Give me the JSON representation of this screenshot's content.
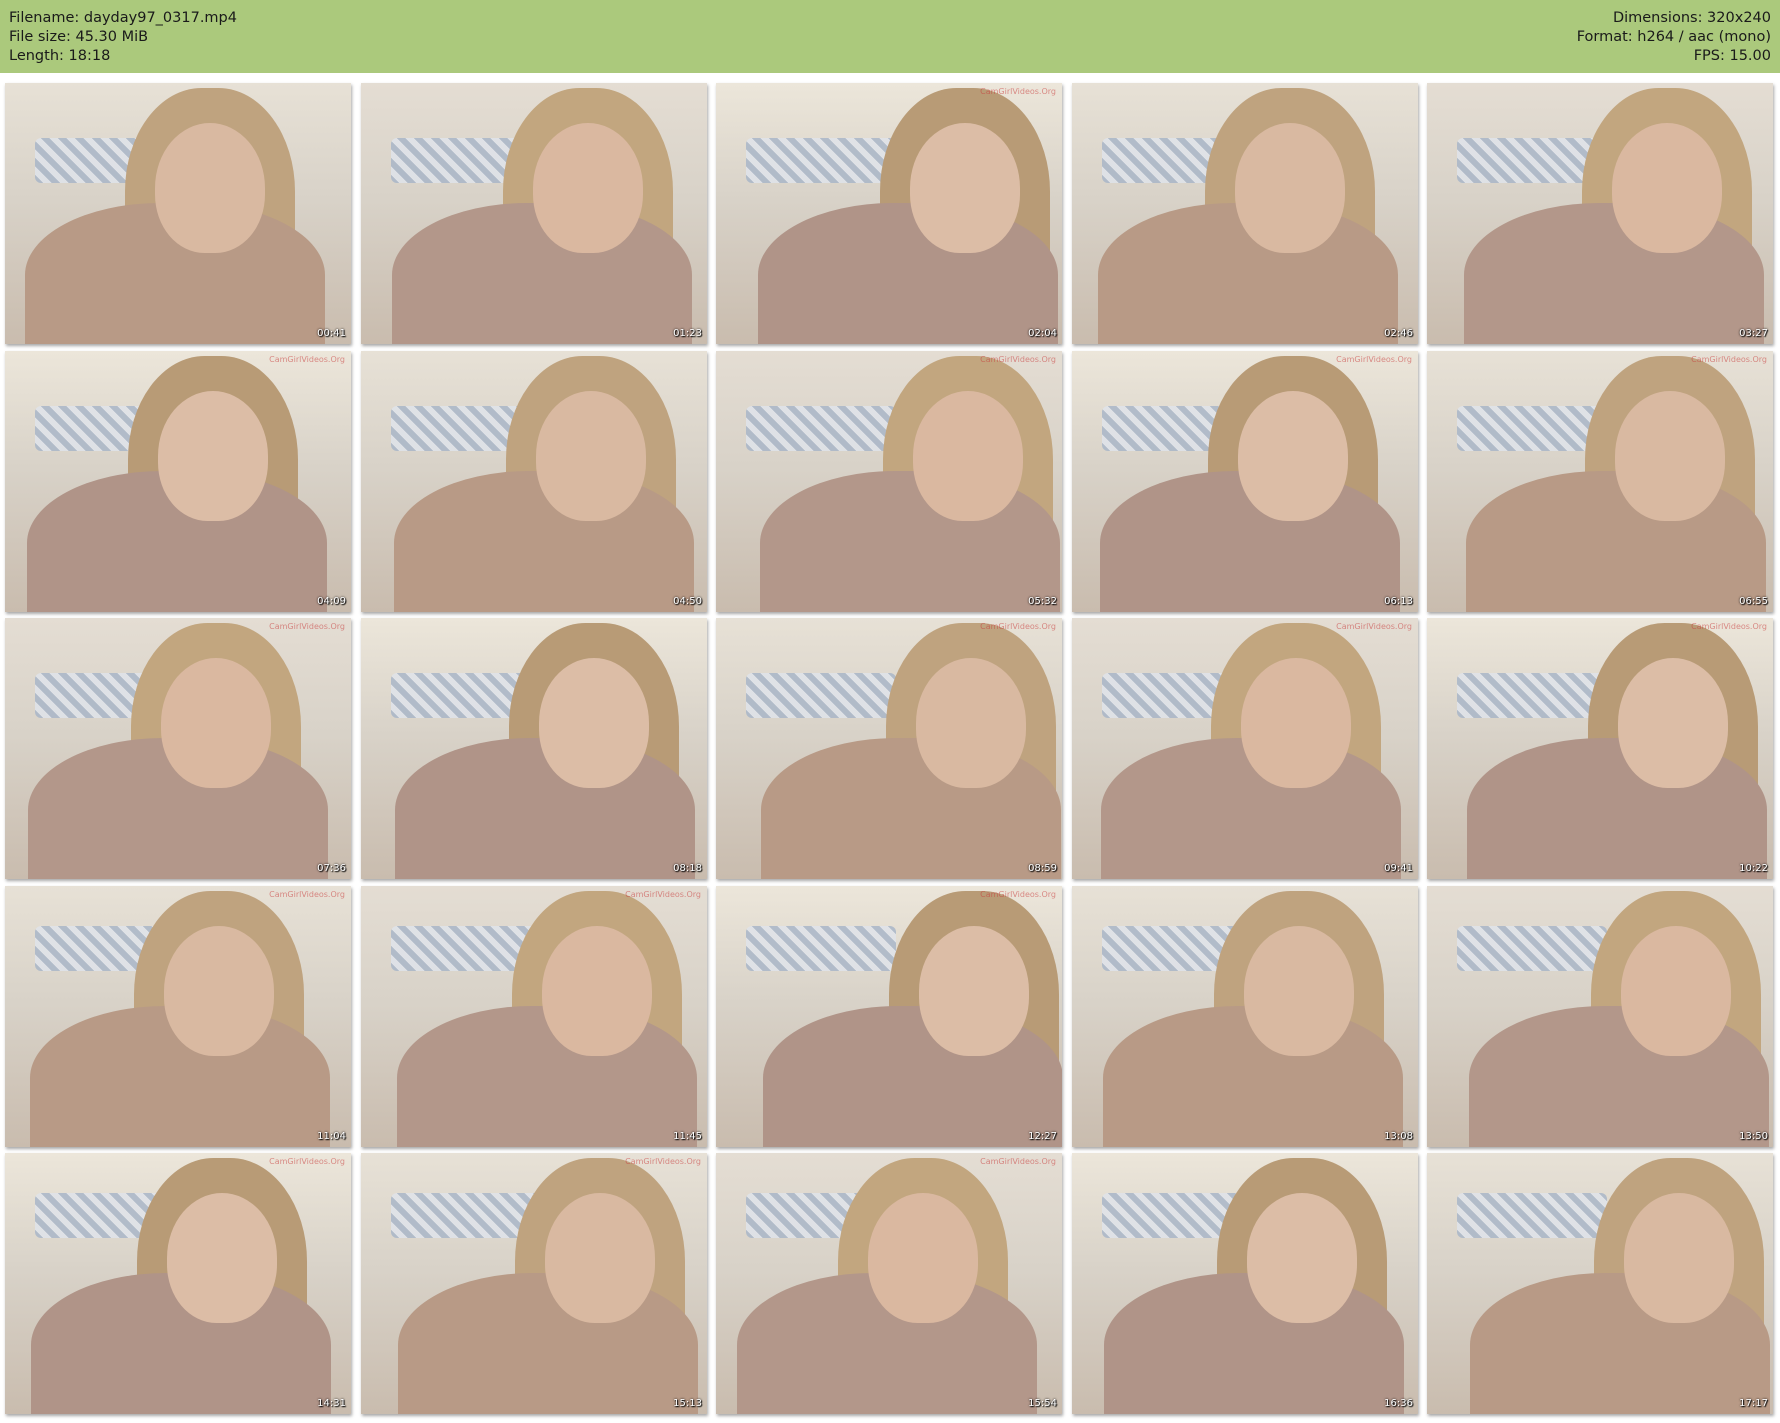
{
  "header": {
    "filename": "Filename: dayday97_0317.mp4",
    "filesize": "File size: 45.30 MiB",
    "length": "Length: 18:18",
    "dimensions": "Dimensions: 320x240",
    "format": "Format: h264 / aac (mono)",
    "fps": "FPS: 15.00"
  },
  "colors": {
    "header_bg": "#abc97c"
  },
  "thumbnails": [
    {
      "time": "00:41",
      "watermark": ""
    },
    {
      "time": "01:23",
      "watermark": ""
    },
    {
      "time": "02:04",
      "watermark": "CamGirlVideos.Org"
    },
    {
      "time": "02:46",
      "watermark": ""
    },
    {
      "time": "03:27",
      "watermark": ""
    },
    {
      "time": "04:09",
      "watermark": "CamGirlVideos.Org"
    },
    {
      "time": "04:50",
      "watermark": ""
    },
    {
      "time": "05:32",
      "watermark": "CamGirlVideos.Org"
    },
    {
      "time": "06:13",
      "watermark": "CamGirlVideos.Org"
    },
    {
      "time": "06:55",
      "watermark": "CamGirlVideos.Org"
    },
    {
      "time": "07:36",
      "watermark": "CamGirlVideos.Org"
    },
    {
      "time": "08:18",
      "watermark": ""
    },
    {
      "time": "08:59",
      "watermark": "CamGirlVideos.Org"
    },
    {
      "time": "09:41",
      "watermark": "CamGirlVideos.Org"
    },
    {
      "time": "10:22",
      "watermark": "CamGirlVideos.Org"
    },
    {
      "time": "11:04",
      "watermark": "CamGirlVideos.Org"
    },
    {
      "time": "11:45",
      "watermark": "CamGirlVideos.Org"
    },
    {
      "time": "12:27",
      "watermark": "CamGirlVideos.Org"
    },
    {
      "time": "13:08",
      "watermark": ""
    },
    {
      "time": "13:50",
      "watermark": ""
    },
    {
      "time": "14:31",
      "watermark": "CamGirlVideos.Org"
    },
    {
      "time": "15:13",
      "watermark": "CamGirlVideos.Org"
    },
    {
      "time": "15:54",
      "watermark": "CamGirlVideos.Org"
    },
    {
      "time": "16:36",
      "watermark": ""
    },
    {
      "time": "17:17",
      "watermark": ""
    }
  ]
}
